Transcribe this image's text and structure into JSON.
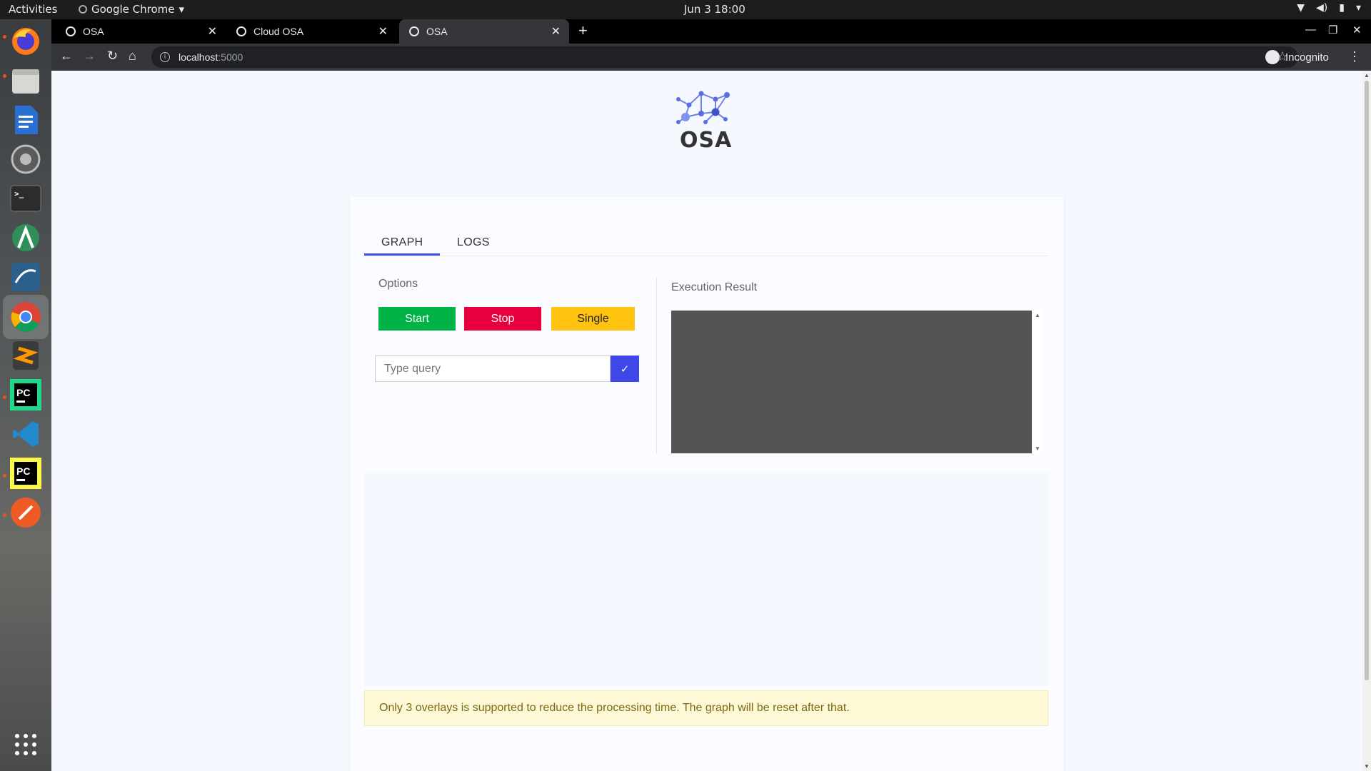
{
  "system_bar": {
    "activities": "Activities",
    "app_name": "Google Chrome",
    "clock": "Jun 3  18:00"
  },
  "browser": {
    "tabs": [
      {
        "title": "OSA"
      },
      {
        "title": "Cloud OSA"
      },
      {
        "title": "OSA"
      }
    ],
    "active_tab": 2,
    "url_host": "localhost",
    "url_port": ":5000",
    "profile_label": "Incognito"
  },
  "app": {
    "logo_text": "OSA",
    "tabs": {
      "graph": "GRAPH",
      "logs": "LOGS"
    },
    "options_label": "Options",
    "buttons": {
      "start": "Start",
      "stop": "Stop",
      "single": "Single"
    },
    "query": {
      "placeholder": "Type query",
      "submit_glyph": "✓"
    },
    "execution_result_label": "Execution Result",
    "alert": "Only 3 overlays is supported to reduce the processing time. The graph will be reset after that."
  },
  "colors": {
    "accent": "#3f51e5",
    "start": "#00b347",
    "stop": "#e8003e",
    "single": "#ffc20e",
    "result_bg": "#545454",
    "alert_bg": "#fdf8d6"
  },
  "dock_icons": [
    "firefox-icon",
    "files-icon",
    "writer-icon",
    "settings-icon",
    "terminal-icon",
    "android-studio-icon",
    "mysql-workbench-icon",
    "chrome-icon",
    "sublime-icon",
    "pycharm-icon",
    "vscode-icon",
    "pycharm-edu-icon",
    "postman-icon",
    "app-grid-icon"
  ]
}
